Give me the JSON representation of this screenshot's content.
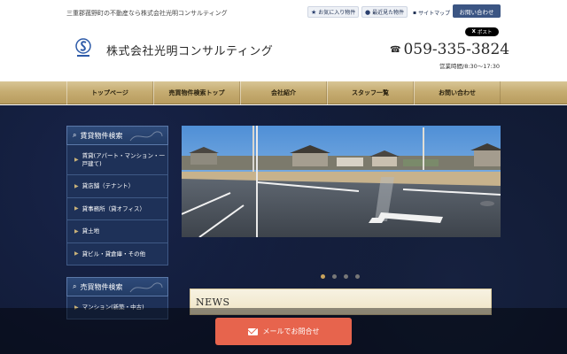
{
  "header": {
    "tagline": "三重郡菰野町の不動産なら株式会社光明コンサルティング",
    "favorites_label": "お気に入り物件",
    "recent_label": "最近見た物件",
    "sitemap_label": "サイトマップ",
    "contact_label": "お問い合わせ",
    "xpost_label": "ポスト",
    "company_name": "株式会社光明コンサルティング",
    "phone": "059-335-3824",
    "hours": "営業時間/8:30〜17:30"
  },
  "nav": {
    "items": [
      {
        "label": "トップページ"
      },
      {
        "label": "売買物件検索トップ"
      },
      {
        "label": "会社紹介"
      },
      {
        "label": "スタッフ一覧"
      },
      {
        "label": "お問い合わせ"
      }
    ]
  },
  "sidebar": {
    "rental_header": "賃貸物件検索",
    "rental_items": [
      {
        "label": "賃貸(アパート・マンション・一戸建て)"
      },
      {
        "label": "貸店舗（テナント）"
      },
      {
        "label": "貸事務所（貸オフィス）"
      },
      {
        "label": "貸土地"
      },
      {
        "label": "貸ビル・貸倉庫・その他"
      }
    ],
    "sale_header": "売買物件検索",
    "sale_items": [
      {
        "label": "マンション(新築・中古)"
      }
    ]
  },
  "slider": {
    "slide_count": 4,
    "active_index": 0
  },
  "news": {
    "title": "NEWS"
  },
  "footer_cta": {
    "mail_label": "メールでお問合せ"
  },
  "colors": {
    "nav_gold": "#c6ad72",
    "navy": "#1e3158",
    "contact_blue": "#3b5583",
    "mail_coral": "#e7644d"
  }
}
